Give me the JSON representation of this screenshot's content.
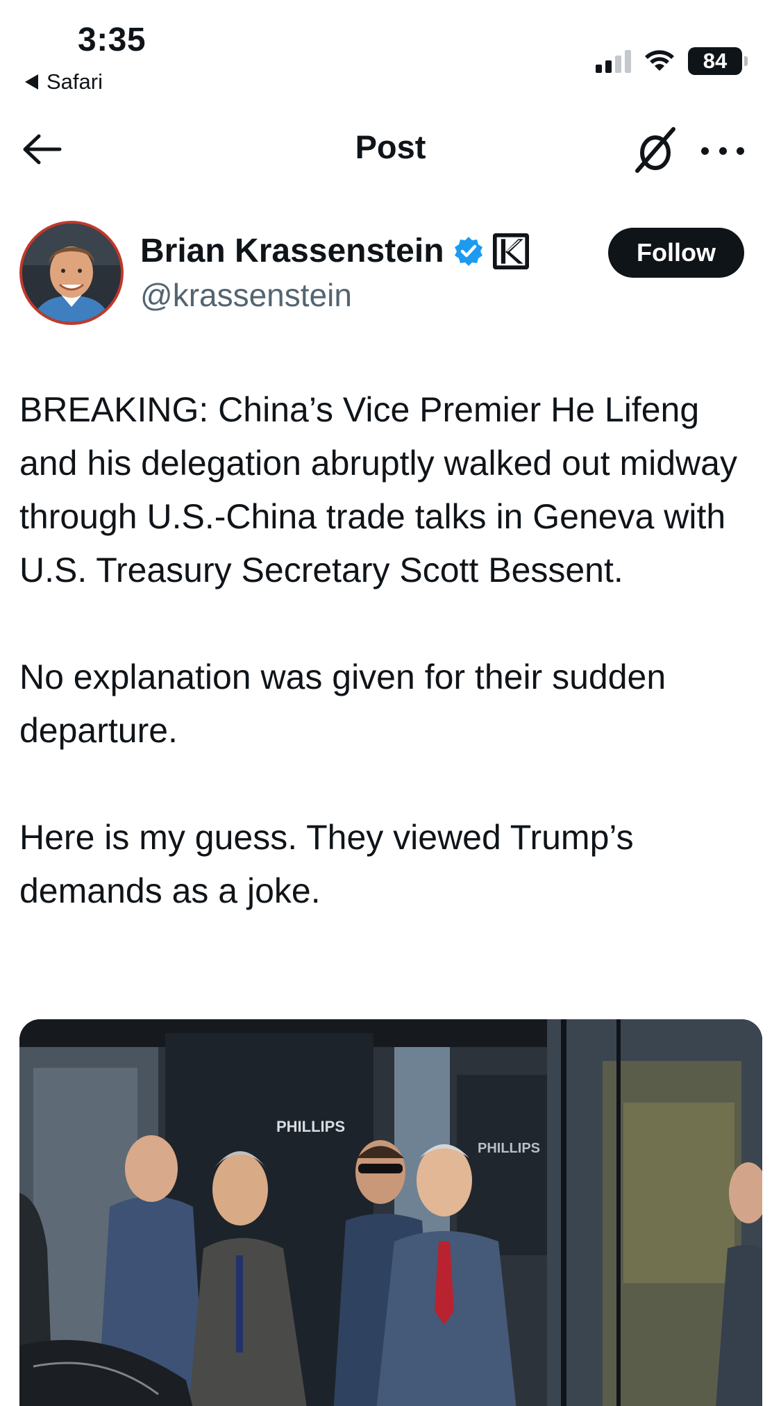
{
  "status_bar": {
    "time": "3:35",
    "back_app": "Safari",
    "battery": "84",
    "signal_level": 2,
    "signal_bars": 4,
    "icons": [
      "signal-icon",
      "wifi-icon",
      "battery-icon"
    ]
  },
  "nav": {
    "title": "Post",
    "icons": [
      "back-arrow-icon",
      "grok-icon",
      "more-icon"
    ]
  },
  "author": {
    "name": "Brian Krassenstein",
    "handle": "@krassenstein",
    "follow_label": "Follow",
    "verified_color": "#1d9bf0",
    "affiliate_icon": "k-badge-icon"
  },
  "tweet": {
    "paragraphs": [
      "BREAKING: China’s Vice Premier He Lifeng and his delegation abruptly walked out midway through U.S.-China trade talks in Geneva with U.S. Treasury Secretary Scott Bessent.",
      "No explanation was given for their sudden departure.",
      "Here is my guess. They viewed Trump’s demands as a joke."
    ]
  },
  "media": {
    "signs": [
      "PHILLIPS",
      "PHILLIPS"
    ]
  },
  "colors": {
    "text": "#0f1419",
    "secondary": "#536471",
    "follow_bg": "#0f1419",
    "verified": "#1d9bf0",
    "avatar_ring": "#c0392b"
  }
}
